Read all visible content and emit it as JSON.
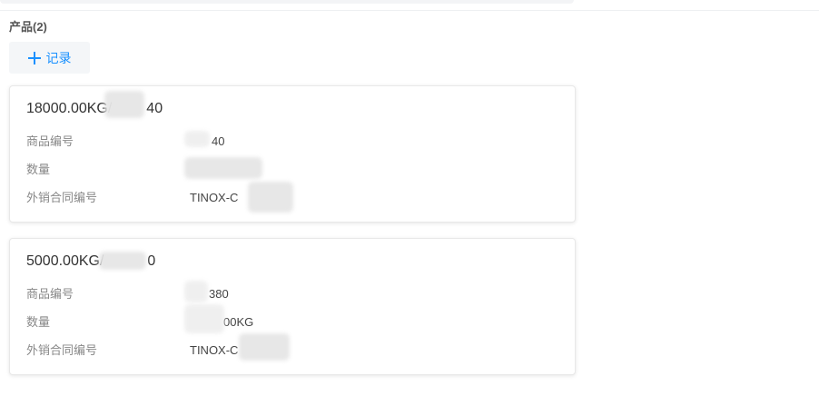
{
  "top": {},
  "section": {
    "title": "产品(2)"
  },
  "add_button": {
    "label": "记录",
    "icon": "plus-icon",
    "color": "#1890ff"
  },
  "cards": [
    {
      "title": "18000.00KG/",
      "title_tail": "40",
      "fields": [
        {
          "label": "商品编号",
          "value": "40"
        },
        {
          "label": "数量",
          "value": ""
        },
        {
          "label": "外销合同编号",
          "value": "TINOX-C"
        }
      ]
    },
    {
      "title": "5000.00KG/",
      "title_tail": "0",
      "fields": [
        {
          "label": "商品编号",
          "value": "380"
        },
        {
          "label": "数量",
          "value": "00KG"
        },
        {
          "label": "外销合同编号",
          "value": "TINOX-C"
        }
      ]
    }
  ],
  "colors": {
    "accent": "#1890ff",
    "label": "#888888",
    "text": "#333333"
  }
}
